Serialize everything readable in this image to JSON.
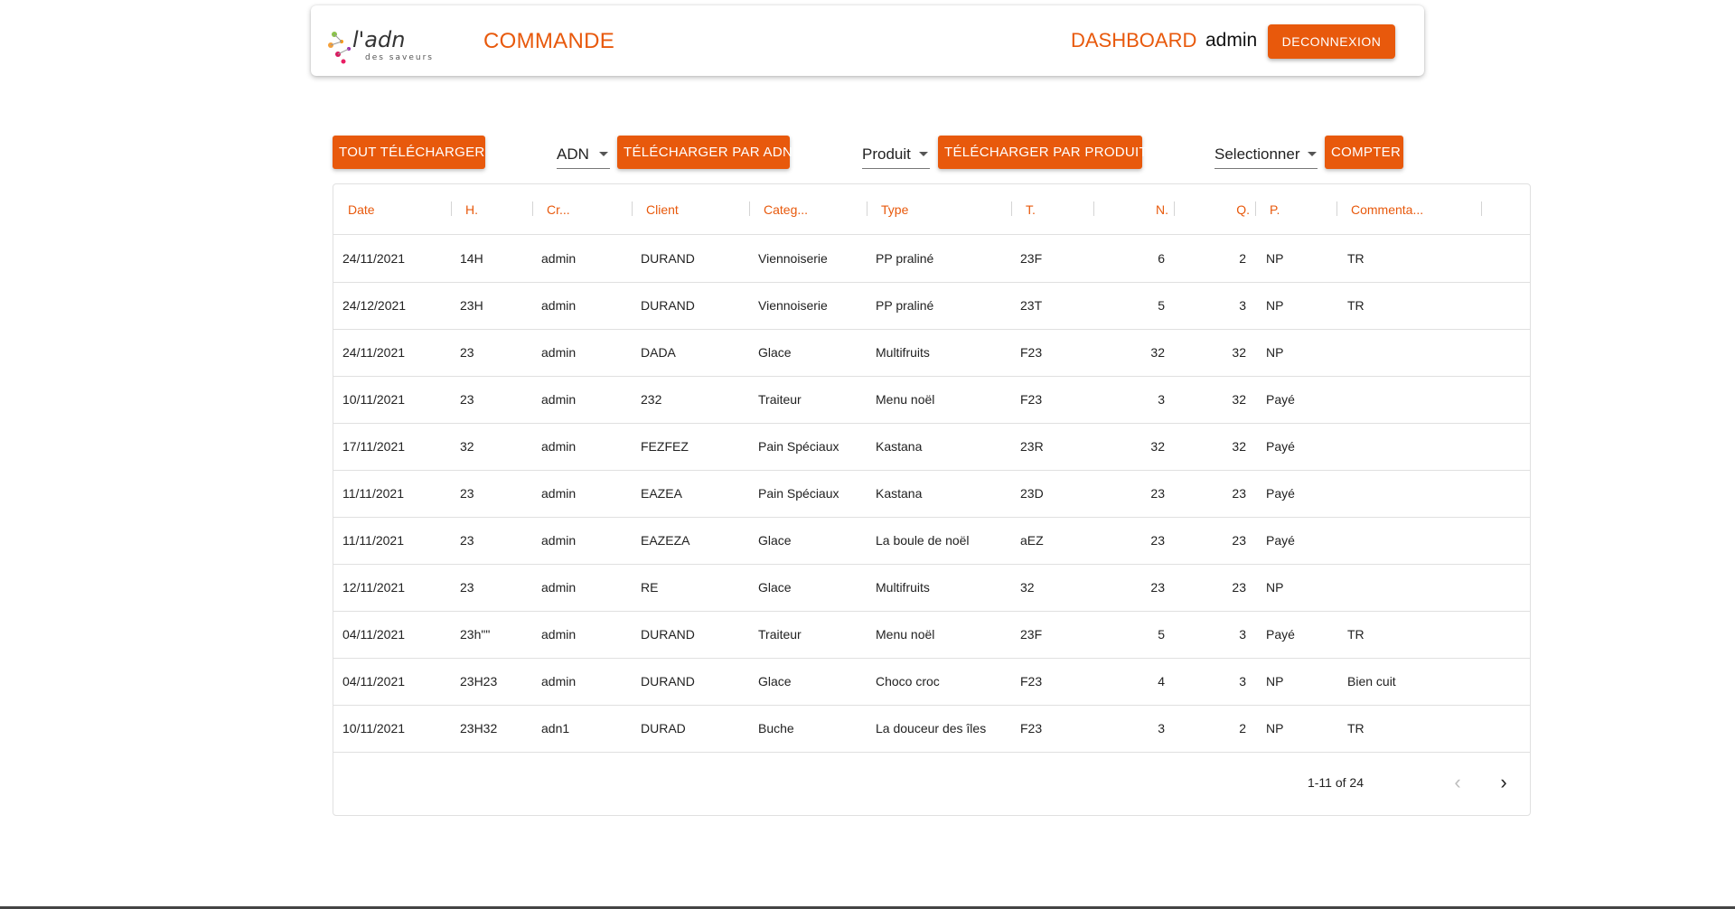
{
  "header": {
    "logo_text": "l'adn",
    "logo_subtext": "des saveurs",
    "title": "COMMANDE",
    "dashboard_link": "DASHBOARD",
    "username": "admin",
    "logout_label": "DECONNEXION"
  },
  "toolbar": {
    "download_all": "TOUT TÉLÉCHARGER",
    "adn_select": "ADN",
    "download_by_adn": "TÉLÉCHARGER PAR ADN",
    "product_select": "Produit",
    "download_by_product": "TÉLÉCHARGER PAR PRODUIT",
    "count_select": "Selectionner",
    "count_button": "COMPTER"
  },
  "colors": {
    "accent": "#e8590c"
  },
  "table": {
    "columns": [
      "Date",
      "H.",
      "Cr...",
      "Client",
      "Categ...",
      "Type",
      "T.",
      "N.",
      "Q.",
      "P.",
      "Commenta..."
    ],
    "rows": [
      [
        "24/11/2021",
        "14H",
        "admin",
        "DURAND",
        "Viennoiserie",
        "PP praliné",
        "23F",
        "6",
        "2",
        "NP",
        "TR"
      ],
      [
        "24/12/2021",
        "23H",
        "admin",
        "DURAND",
        "Viennoiserie",
        "PP praliné",
        "23T",
        "5",
        "3",
        "NP",
        "TR"
      ],
      [
        "24/11/2021",
        "23",
        "admin",
        "DADA",
        "Glace",
        "Multifruits",
        "F23",
        "32",
        "32",
        "NP",
        ""
      ],
      [
        "10/11/2021",
        "23",
        "admin",
        "232",
        "Traiteur",
        "Menu noël",
        "F23",
        "3",
        "32",
        "Payé",
        ""
      ],
      [
        "17/11/2021",
        "32",
        "admin",
        "FEZFEZ",
        "Pain Spéciaux",
        "Kastana",
        "23R",
        "32",
        "32",
        "Payé",
        ""
      ],
      [
        "11/11/2021",
        "23",
        "admin",
        "EAZEA",
        "Pain Spéciaux",
        "Kastana",
        "23D",
        "23",
        "23",
        "Payé",
        ""
      ],
      [
        "11/11/2021",
        "23",
        "admin",
        "EAZEZA",
        "Glace",
        "La boule de noël",
        "aEZ",
        "23",
        "23",
        "Payé",
        ""
      ],
      [
        "12/11/2021",
        "23",
        "admin",
        "RE",
        "Glace",
        "Multifruits",
        "32",
        "23",
        "23",
        "NP",
        ""
      ],
      [
        "04/11/2021",
        "23h\"\"",
        "admin",
        "DURAND",
        "Traiteur",
        "Menu noël",
        "23F",
        "5",
        "3",
        "Payé",
        "TR"
      ],
      [
        "04/11/2021",
        "23H23",
        "admin",
        "DURAND",
        "Glace",
        "Choco croc",
        "F23",
        "4",
        "3",
        "NP",
        "Bien cuit"
      ],
      [
        "10/11/2021",
        "23H32",
        "adn1",
        "DURAD",
        "Buche",
        "La douceur des îles",
        "F23",
        "3",
        "2",
        "NP",
        "TR"
      ]
    ]
  },
  "pagination": {
    "range_text": "1-11 of 24",
    "prev_icon": "chevron-left-icon",
    "next_icon": "chevron-right-icon"
  }
}
